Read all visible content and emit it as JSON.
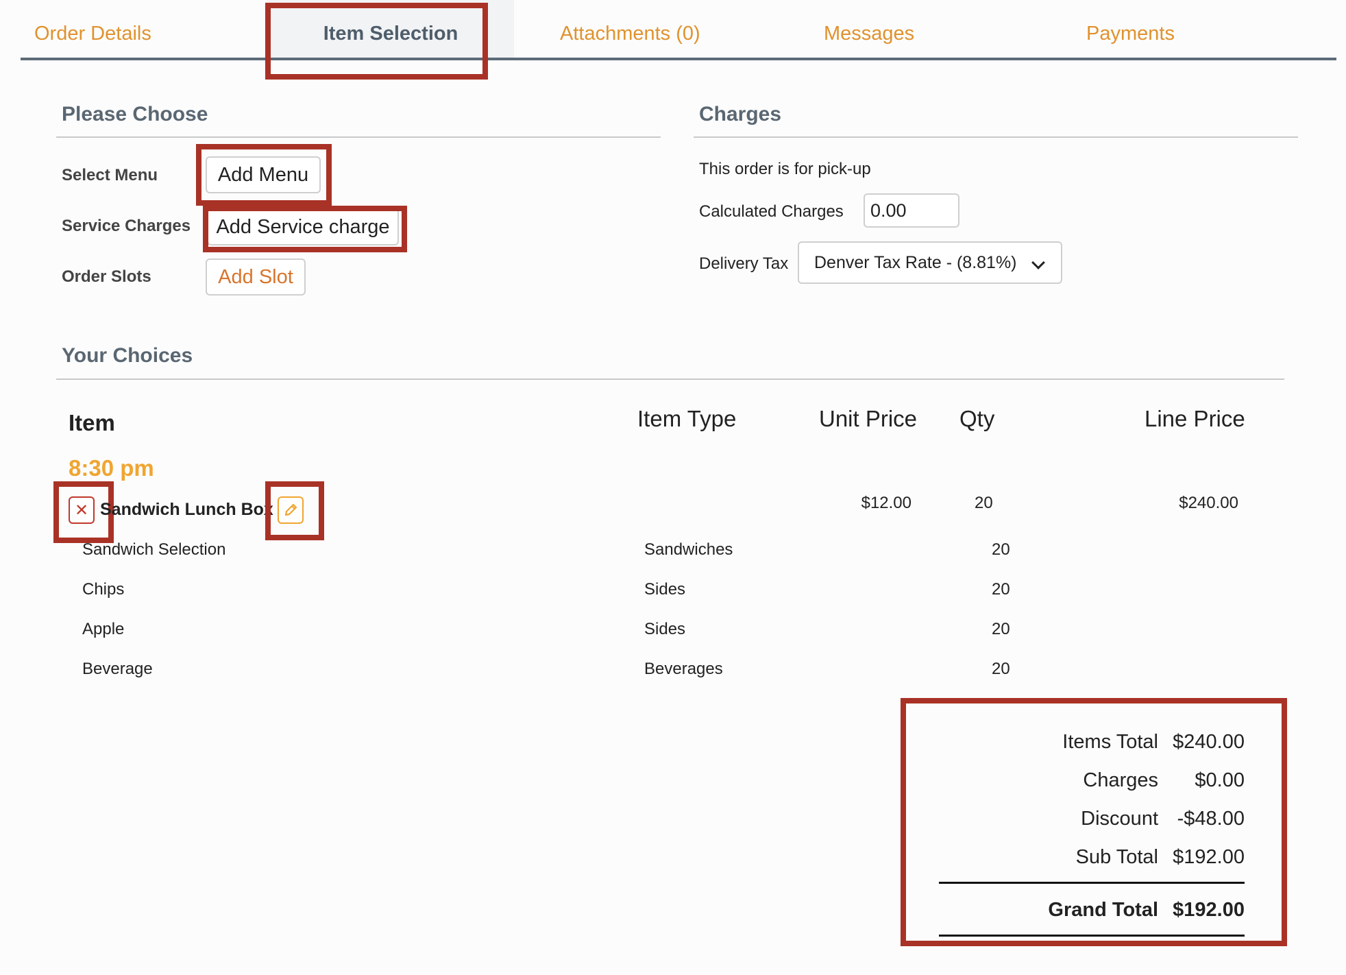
{
  "tabs": [
    {
      "label": "Order Details"
    },
    {
      "label": "Item Selection"
    },
    {
      "label": "Attachments (0)"
    },
    {
      "label": "Messages"
    },
    {
      "label": "Payments"
    }
  ],
  "please_choose": {
    "title": "Please Choose",
    "select_menu_label": "Select Menu",
    "add_menu_button": "Add Menu",
    "service_charges_label": "Service Charges",
    "add_service_charge_button": "Add Service charge",
    "order_slots_label": "Order Slots",
    "add_slot_button": "Add Slot"
  },
  "charges": {
    "title": "Charges",
    "pickup_note": "This order is for pick-up",
    "calculated_label": "Calculated Charges",
    "calculated_value": "0.00",
    "delivery_tax_label": "Delivery Tax",
    "delivery_tax_selected": "Denver Tax Rate - (8.81%)"
  },
  "choices": {
    "title": "Your Choices",
    "headers": {
      "item": "Item",
      "item_type": "Item Type",
      "unit_price": "Unit Price",
      "qty": "Qty",
      "line_price": "Line Price"
    },
    "time_slot": "8:30 pm",
    "main_item": {
      "name": "Sandwich Lunch Box",
      "unit_price": "$12.00",
      "qty": "20",
      "line_price": "$240.00"
    },
    "sub_items": [
      {
        "name": "Sandwich Selection",
        "type": "Sandwiches",
        "qty": "20"
      },
      {
        "name": "Chips",
        "type": "Sides",
        "qty": "20"
      },
      {
        "name": "Apple",
        "type": "Sides",
        "qty": "20"
      },
      {
        "name": "Beverage",
        "type": "Beverages",
        "qty": "20"
      }
    ]
  },
  "totals": {
    "items_total_label": "Items Total",
    "items_total": "$240.00",
    "charges_label": "Charges",
    "charges": "$0.00",
    "discount_label": "Discount",
    "discount": "-$48.00",
    "sub_total_label": "Sub Total",
    "sub_total": "$192.00",
    "grand_total_label": "Grand Total",
    "grand_total": "$192.00"
  },
  "colors": {
    "accent": "#e0922e",
    "highlight": "#a93226",
    "tab_underline": "#5c6b78"
  },
  "icons": {
    "delete": "close-icon",
    "edit": "pencil-icon"
  }
}
